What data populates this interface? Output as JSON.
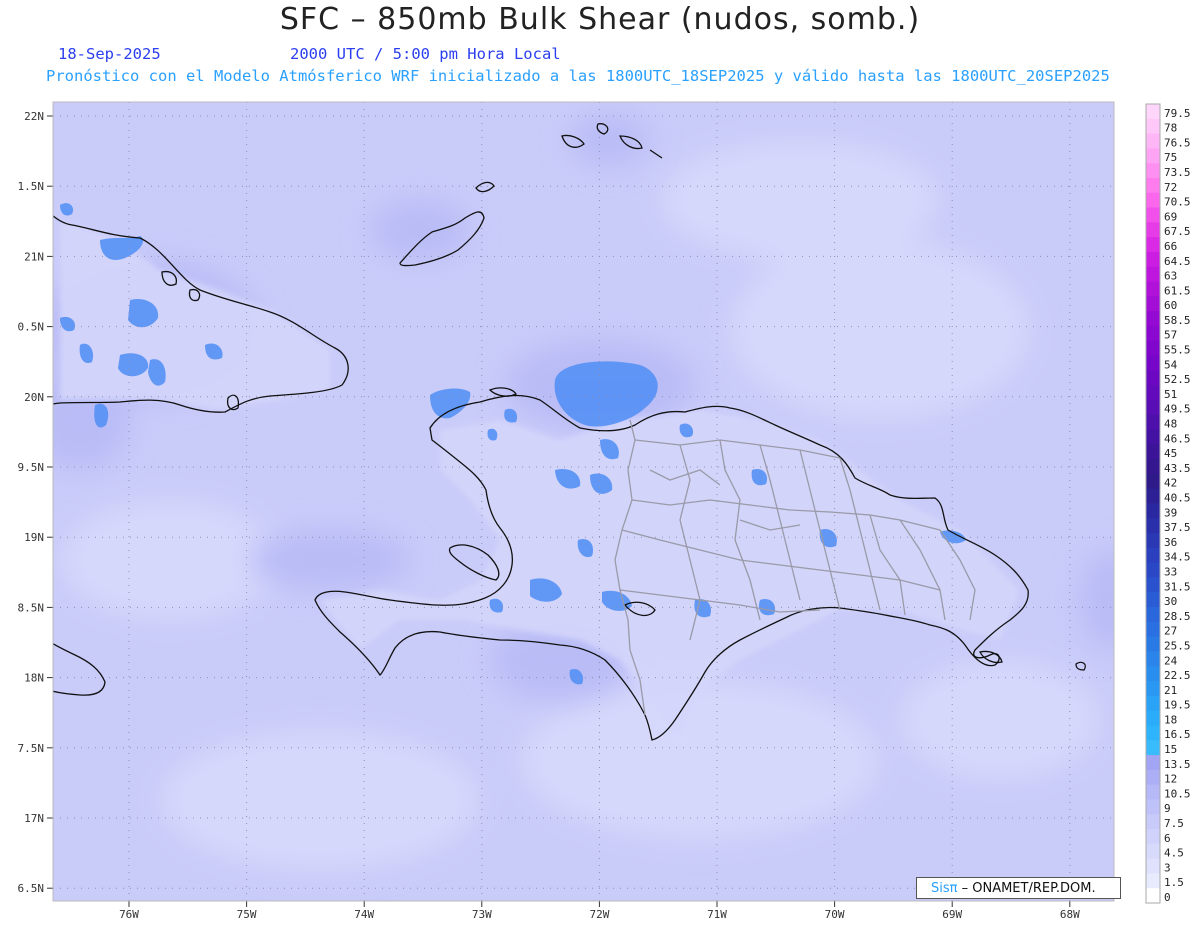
{
  "header": {
    "title": "SFC – 850mb Bulk Shear (nudos, somb.)",
    "date": "18-Sep-2025",
    "time": "2000 UTC / 5:00 pm Hora Local",
    "forecast": "Pronóstico con el Modelo Atmósferico WRF inicializado a las 1800UTC_18SEP2025 y válido hasta las  1800UTC_20SEP2025"
  },
  "axes": {
    "lat_labels": [
      "22N",
      "1.5N",
      "21N",
      "0.5N",
      "20N",
      "9.5N",
      "19N",
      "8.5N",
      "18N",
      "7.5N",
      "17N",
      "6.5N"
    ],
    "lon_labels": [
      "76W",
      "75W",
      "74W",
      "73W",
      "72W",
      "71W",
      "70W",
      "69W",
      "68W"
    ]
  },
  "legend": {
    "levels": [
      "79.5",
      "78",
      "76.5",
      "75",
      "73.5",
      "72",
      "70.5",
      "69",
      "67.5",
      "66",
      "64.5",
      "63",
      "61.5",
      "60",
      "58.5",
      "57",
      "55.5",
      "54",
      "52.5",
      "51",
      "49.5",
      "48",
      "46.5",
      "45",
      "43.5",
      "42",
      "40.5",
      "39",
      "37.5",
      "36",
      "34.5",
      "33",
      "31.5",
      "30",
      "28.5",
      "27",
      "25.5",
      "24",
      "22.5",
      "21",
      "19.5",
      "18",
      "16.5",
      "15",
      "13.5",
      "12",
      "10.5",
      "9",
      "7.5",
      "6",
      "4.5",
      "3",
      "1.5",
      "0"
    ],
    "colors": [
      "#ffd6fb",
      "#ffc8f9",
      "#ffb6f7",
      "#ffa4f5",
      "#ff90f2",
      "#ff7cee",
      "#fa66ec",
      "#f150ea",
      "#e63ce8",
      "#da2ae6",
      "#cc1ee2",
      "#be16de",
      "#b012da",
      "#a20ed6",
      "#940ad2",
      "#8a08d0",
      "#8006cc",
      "#7606c8",
      "#6c08c2",
      "#620abc",
      "#580eb4",
      "#4e10aa",
      "#4412a2",
      "#3c1498",
      "#34168e",
      "#2e1a88",
      "#2c2094",
      "#2a28a0",
      "#2a30aa",
      "#2a38b4",
      "#2a40be",
      "#2a48c6",
      "#2a52ce",
      "#2a5cd6",
      "#2a66dc",
      "#2a70e2",
      "#2a7ae6",
      "#2a84ea",
      "#2a8eee",
      "#2a98f2",
      "#2aa2f6",
      "#2aacfa",
      "#2eb4fc",
      "#38bcfe",
      "#a2a4f4",
      "#acaef6",
      "#b6b8f8",
      "#bfc1f9",
      "#c8cafa",
      "#d0d2fb",
      "#d8dafc",
      "#e0e2fd",
      "#e8eafe",
      "#ffffff"
    ]
  },
  "credit": {
    "sis": "Sisπ",
    "org": " – ONAMET/REP.DOM."
  }
}
